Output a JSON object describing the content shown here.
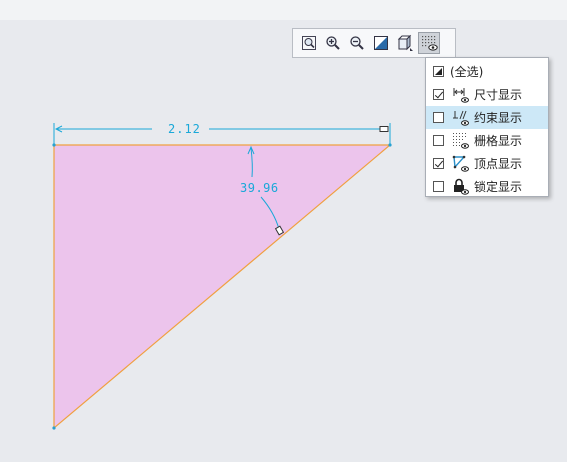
{
  "colors": {
    "background": "#e8eaee",
    "triangle_fill": "#ecc4ec",
    "triangle_edge": "#f0a040",
    "dimension": "#1aa8d8",
    "menu_hover": "#cde8f7"
  },
  "sketch": {
    "linear_dimension": "2.12",
    "angular_dimension": "39.96"
  },
  "toolbar": {
    "buttons": [
      {
        "icon": "zoom-fit-icon"
      },
      {
        "icon": "zoom-in-icon"
      },
      {
        "icon": "zoom-out-icon"
      },
      {
        "icon": "sketch-view-icon"
      },
      {
        "icon": "shaded-cube-icon"
      },
      {
        "icon": "sketcher-display-icon",
        "active": true
      }
    ]
  },
  "display_menu": {
    "items": [
      {
        "label": "(全选)",
        "checked": "partial",
        "icon": "select-all-icon"
      },
      {
        "label": "尺寸显示",
        "checked": true,
        "icon": "dimension-display-icon"
      },
      {
        "label": "约束显示",
        "checked": false,
        "icon": "constraint-display-icon",
        "hover": true
      },
      {
        "label": "栅格显示",
        "checked": false,
        "icon": "grid-display-icon"
      },
      {
        "label": "顶点显示",
        "checked": true,
        "icon": "vertex-display-icon"
      },
      {
        "label": "锁定显示",
        "checked": false,
        "icon": "lock-display-icon"
      }
    ]
  }
}
